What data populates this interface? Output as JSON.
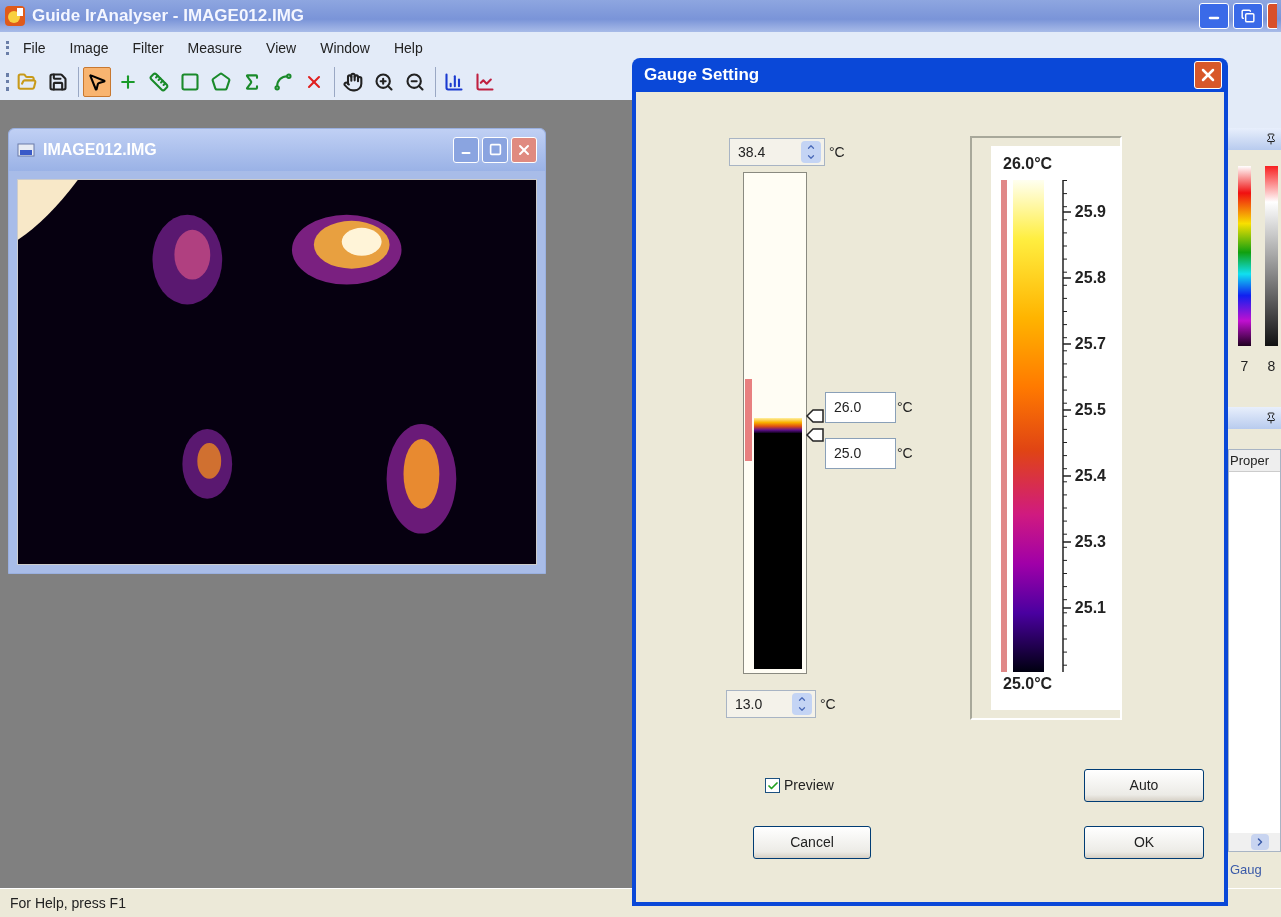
{
  "app": {
    "title": "Guide IrAnalyser - IMAGE012.IMG"
  },
  "menu": [
    {
      "label": "File"
    },
    {
      "label": "Image"
    },
    {
      "label": "Filter"
    },
    {
      "label": "Measure"
    },
    {
      "label": "View"
    },
    {
      "label": "Window"
    },
    {
      "label": "Help"
    }
  ],
  "toolbar": [
    {
      "items": [
        {
          "kind": "open",
          "selected": false
        },
        {
          "kind": "save",
          "selected": false
        }
      ]
    },
    {
      "items": [
        {
          "kind": "pointer",
          "selected": true
        },
        {
          "kind": "point",
          "selected": false
        },
        {
          "kind": "line",
          "selected": false
        },
        {
          "kind": "rectangle",
          "selected": false
        },
        {
          "kind": "polygon",
          "selected": false
        },
        {
          "kind": "area",
          "selected": false
        },
        {
          "kind": "polyline",
          "selected": false
        },
        {
          "kind": "delete",
          "selected": false
        }
      ]
    },
    {
      "items": [
        {
          "kind": "pan",
          "selected": false
        },
        {
          "kind": "zoom-in",
          "selected": false
        },
        {
          "kind": "zoom-out",
          "selected": false
        }
      ]
    },
    {
      "items": [
        {
          "kind": "histogram",
          "selected": false
        },
        {
          "kind": "profile",
          "selected": false
        }
      ]
    }
  ],
  "child_window": {
    "title": "IMAGE012.IMG"
  },
  "dialog": {
    "title": "Gauge Setting",
    "max": {
      "value": "38.4",
      "unit": "°C"
    },
    "upper": {
      "value": "26.0",
      "unit": "°C"
    },
    "lower": {
      "value": "25.0",
      "unit": "°C"
    },
    "min": {
      "value": "13.0",
      "unit": "°C"
    },
    "scale": {
      "top": "26.0°C",
      "bottom": "25.0°C",
      "ticks": [
        "25.9",
        "25.8",
        "25.7",
        "25.5",
        "25.4",
        "25.3",
        "25.1"
      ]
    },
    "preview": {
      "label": "Preview",
      "checked": true
    },
    "buttons": [
      {
        "label": "Auto"
      },
      {
        "label": "Cancel"
      },
      {
        "label": "OK"
      }
    ]
  },
  "right_panel": {
    "palette_labels": [
      "7",
      "8"
    ],
    "column": "Proper",
    "tab": "Gaug"
  },
  "status_bar": "For Help, press F1"
}
